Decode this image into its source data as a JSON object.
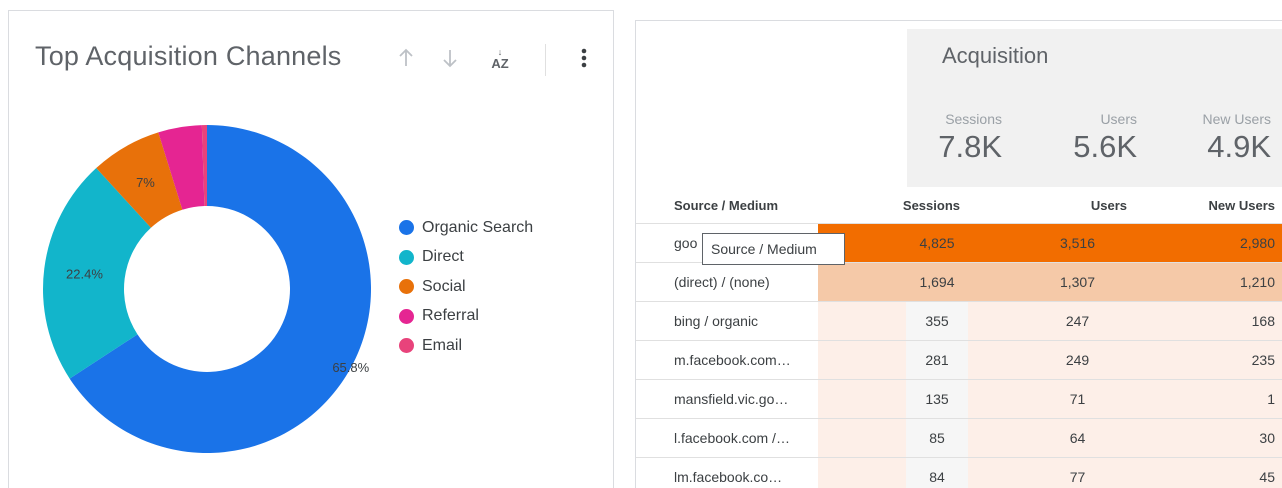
{
  "left_card": {
    "title": "Top Acquisition Channels",
    "toolbar": {
      "sort_asc_icon": "arrow-up-icon",
      "sort_desc_icon": "arrow-down-icon",
      "sort_az_label": "AZ",
      "more_icon": "more-vertical-icon"
    },
    "chart_data": {
      "type": "pie",
      "donut": true,
      "categories": [
        "Organic Search",
        "Direct",
        "Social",
        "Referral",
        "Email"
      ],
      "values": [
        65.8,
        22.4,
        7.0,
        4.3,
        0.5
      ],
      "value_labels": [
        "65.8%",
        "22.4%",
        "7%",
        "",
        ""
      ],
      "colors": [
        "#1a73e8",
        "#12b5cb",
        "#e8710a",
        "#e52592",
        "#e8437b"
      ],
      "legend_position": "right"
    }
  },
  "right_card": {
    "group_title": "Acquisition",
    "scorecards": [
      {
        "label": "Sessions",
        "value": "7.8K"
      },
      {
        "label": "Users",
        "value": "5.6K"
      },
      {
        "label": "New Users",
        "value": "4.9K"
      }
    ],
    "table": {
      "columns": [
        "Source / Medium",
        "Sessions",
        "Users",
        "New Users"
      ],
      "rows": [
        {
          "source": "goo",
          "sessions": "4,825",
          "users": "3,516",
          "new_users": "2,980"
        },
        {
          "source": "(direct) / (none)",
          "sessions": "1,694",
          "users": "1,307",
          "new_users": "1,210"
        },
        {
          "source": "bing / organic",
          "sessions": "355",
          "users": "247",
          "new_users": "168"
        },
        {
          "source": "m.facebook.com…",
          "sessions": "281",
          "users": "249",
          "new_users": "235"
        },
        {
          "source": "mansfield.vic.go…",
          "sessions": "135",
          "users": "71",
          "new_users": "1"
        },
        {
          "source": "l.facebook.com /…",
          "sessions": "85",
          "users": "64",
          "new_users": "30"
        },
        {
          "source": "lm.facebook.co…",
          "sessions": "84",
          "users": "77",
          "new_users": "45"
        }
      ]
    },
    "tooltip": "Source / Medium",
    "heat_colors": {
      "high": "#f26d00",
      "mid": "#f5c9a8",
      "low": "#fdefe8"
    }
  }
}
